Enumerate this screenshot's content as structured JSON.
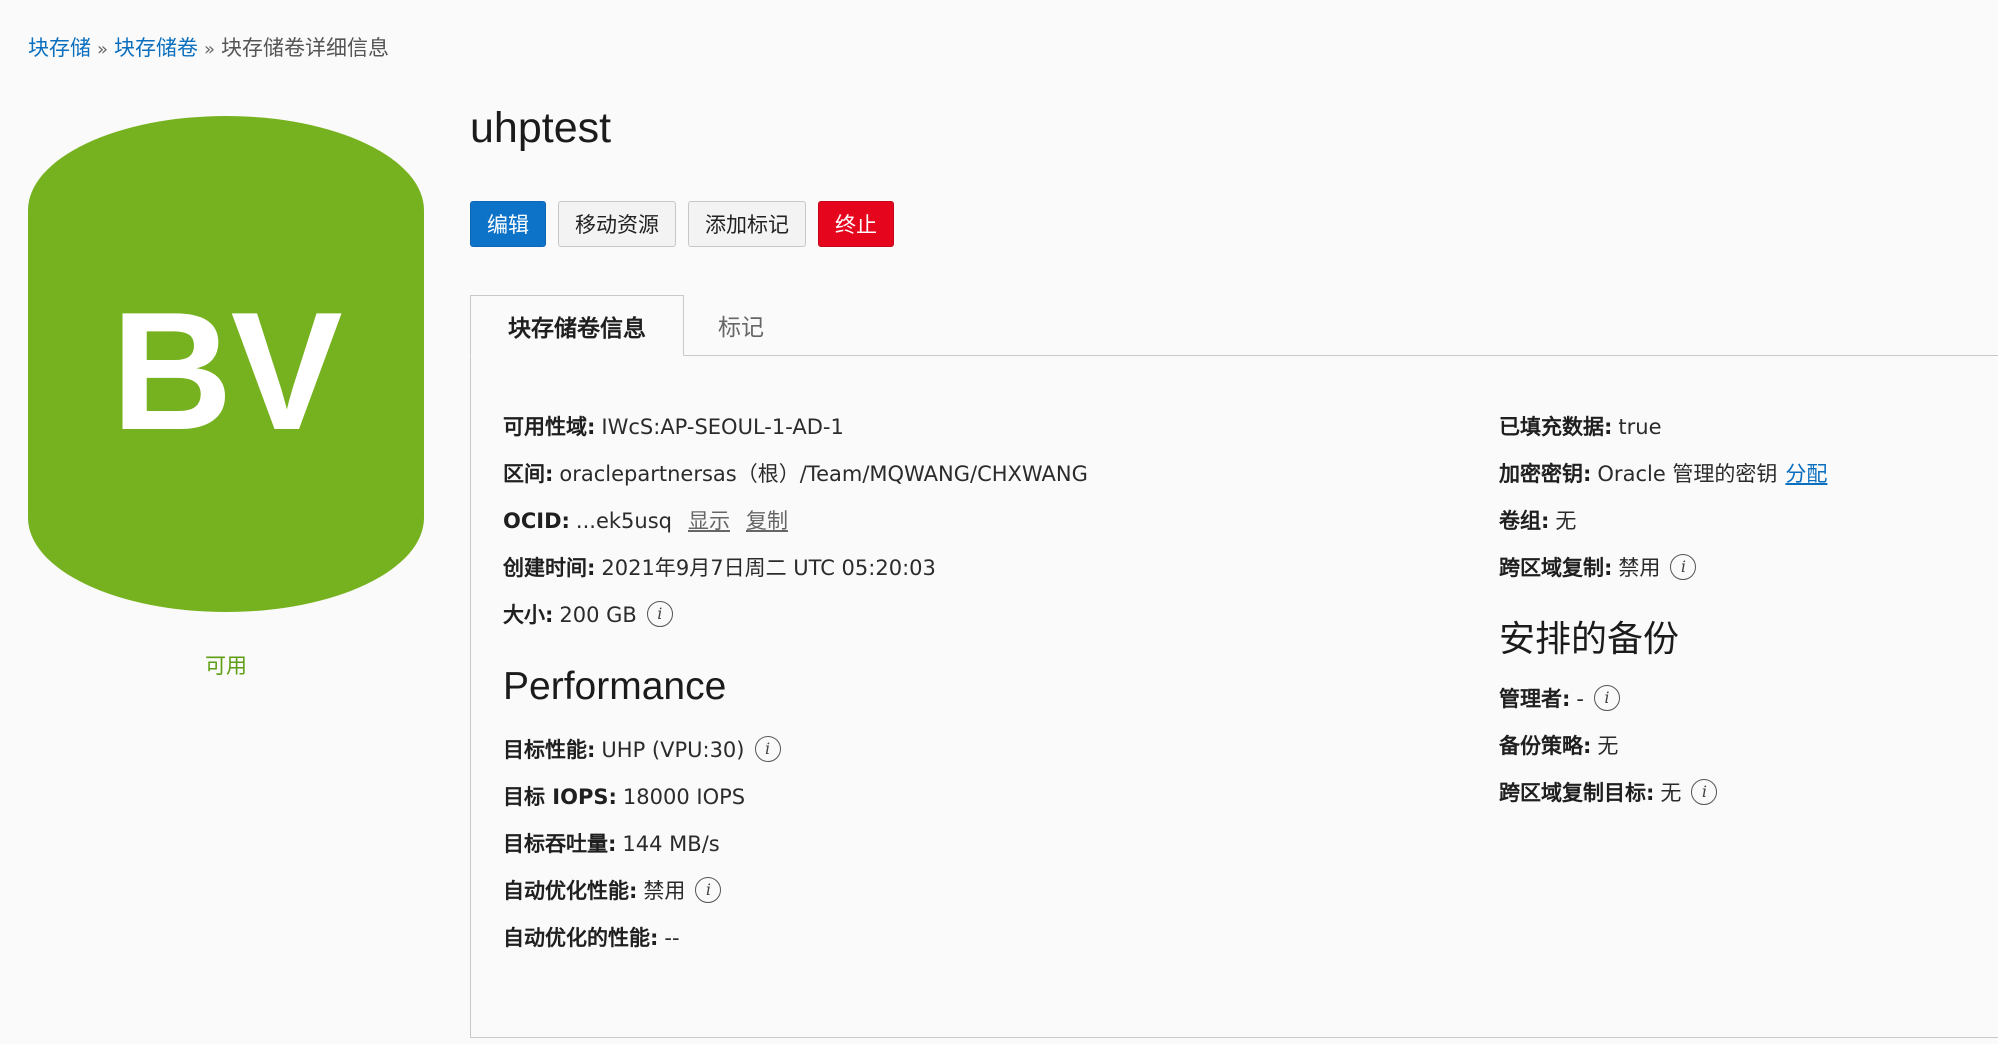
{
  "breadcrumb": {
    "items": [
      "块存储",
      "块存储卷"
    ],
    "current": "块存储卷详细信息",
    "separator": "»"
  },
  "resource": {
    "icon_text": "BV",
    "icon_color": "#76b21f",
    "status": "可用",
    "title": "uhptest"
  },
  "actions": {
    "edit": "编辑",
    "move": "移动资源",
    "add_tags": "添加标记",
    "terminate": "终止"
  },
  "tabs": {
    "info": "块存储卷信息",
    "tags": "标记"
  },
  "info_icon": "i",
  "details": {
    "availability_domain": {
      "label": "可用性域:",
      "value": "IWcS:AP-SEOUL-1-AD-1"
    },
    "compartment": {
      "label": "区间:",
      "value": "oraclepartnersas（根）/Team/MQWANG/CHXWANG"
    },
    "ocid": {
      "label": "OCID:",
      "value": "...ek5usq",
      "show": "显示",
      "copy": "复制"
    },
    "created": {
      "label": "创建时间:",
      "value": "2021年9月7日周二 UTC 05:20:03"
    },
    "size": {
      "label": "大小:",
      "value": "200 GB"
    }
  },
  "performance": {
    "heading": "Performance",
    "target_perf": {
      "label": "目标性能:",
      "value": "UHP (VPU:30)"
    },
    "target_iops": {
      "label": "目标 IOPS:",
      "value": "18000 IOPS"
    },
    "target_throughput": {
      "label": "目标吞吐量:",
      "value": "144 MB/s"
    },
    "auto_tune": {
      "label": "自动优化性能:",
      "value": "禁用"
    },
    "auto_tuned": {
      "label": "自动优化的性能:",
      "value": "--"
    }
  },
  "right": {
    "hydrated": {
      "label": "已填充数据:",
      "value": "true"
    },
    "encryption": {
      "label": "加密密钥:",
      "value": "Oracle 管理的密钥",
      "link": "分配"
    },
    "volume_group": {
      "label": "卷组:",
      "value": "无"
    },
    "cross_region": {
      "label": "跨区域复制:",
      "value": "禁用"
    }
  },
  "backups": {
    "heading": "安排的备份",
    "manager": {
      "label": "管理者:",
      "value": "-"
    },
    "policy": {
      "label": "备份策略:",
      "value": "无"
    },
    "cross_region_target": {
      "label": "跨区域复制目标:",
      "value": "无"
    }
  }
}
